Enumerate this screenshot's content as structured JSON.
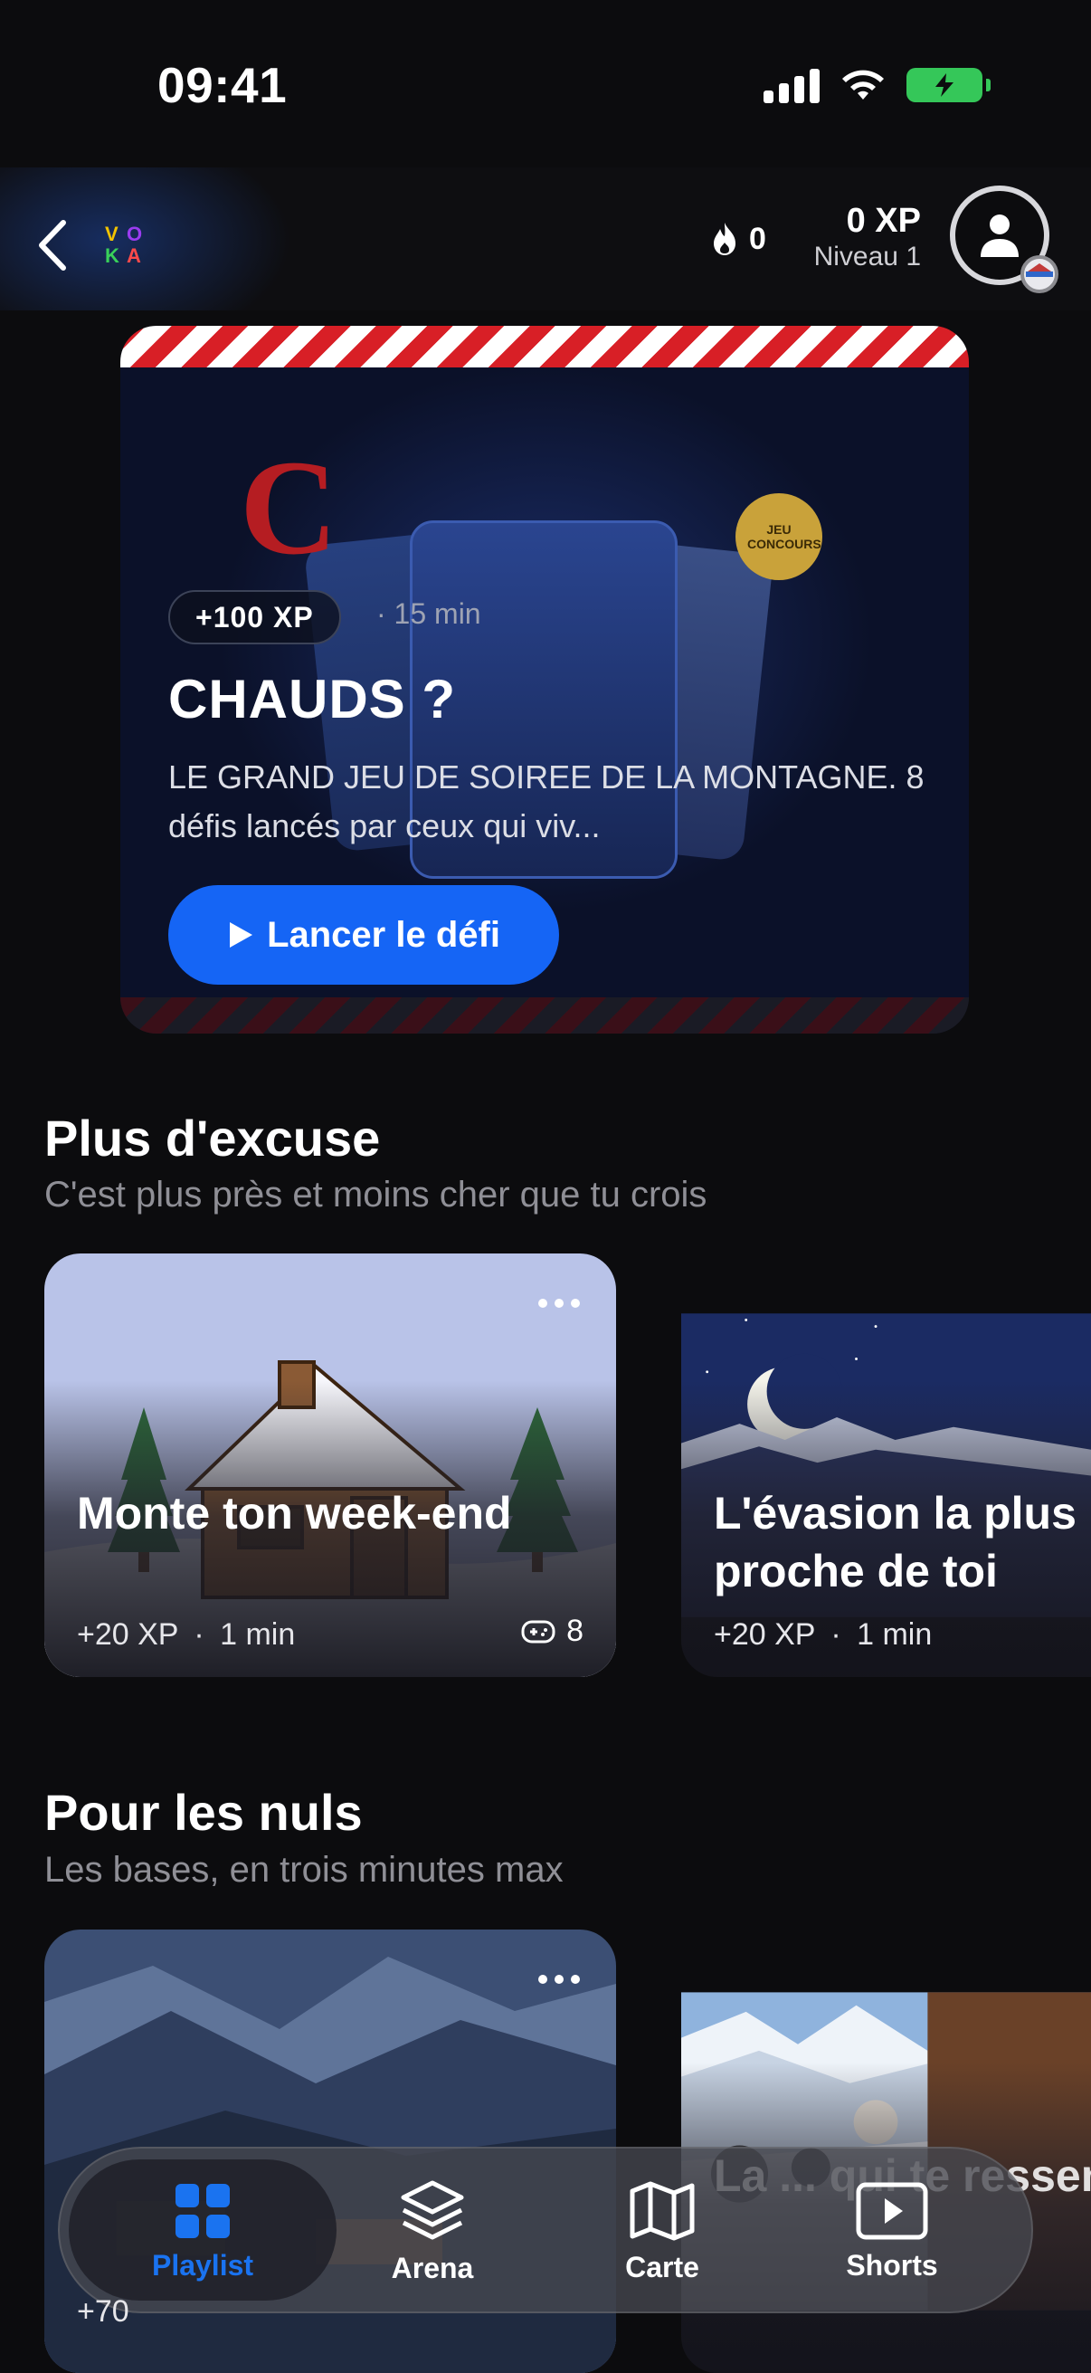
{
  "status_bar": {
    "time": "09:41"
  },
  "header": {
    "streak_count": "0",
    "xp": "0 XP",
    "level": "Niveau 1",
    "logo_letters": [
      "V",
      "O",
      "K",
      "A"
    ]
  },
  "hero": {
    "xp_badge": "+100 XP",
    "duration": "· 15 min",
    "title": "CHAUDS ?",
    "description": "LE GRAND JEU DE SOIREE DE LA MONTAGNE. 8 défis lancés par ceux qui viv...",
    "cta_label": "Lancer le défi",
    "card_letter": "C",
    "seal_text": "JEU CONCOURS",
    "stripe_color": "#d81f26",
    "cta_color": "#1565f5"
  },
  "sections": [
    {
      "title": "Plus d'excuse",
      "subtitle": "C'est plus près et moins cher que tu crois",
      "tiles": [
        {
          "title": "Monte ton week-end",
          "xp": "+20 XP",
          "duration": "1 min",
          "count": "8",
          "scene": "snowy-cabin"
        },
        {
          "title": "L'évasion la plus proche de toi",
          "xp": "+20 XP",
          "duration": "1 min",
          "scene": "moon-mountains"
        }
      ]
    },
    {
      "title": "Pour les nuls",
      "subtitle": "Les bases, en trois minutes max",
      "tiles": [
        {
          "title": "",
          "xp": "+70",
          "scene": "alpine-village"
        },
        {
          "title": "La ... qui te ressemble",
          "scene": "skiers-snow"
        }
      ]
    }
  ],
  "nav": {
    "items": [
      {
        "label": "Playlist",
        "icon": "grid-icon",
        "active": true
      },
      {
        "label": "Arena",
        "icon": "layers-icon",
        "active": false
      },
      {
        "label": "Carte",
        "icon": "map-icon",
        "active": false
      },
      {
        "label": "Shorts",
        "icon": "play-square-icon",
        "active": false
      }
    ],
    "active_color": "#1a73f0"
  }
}
